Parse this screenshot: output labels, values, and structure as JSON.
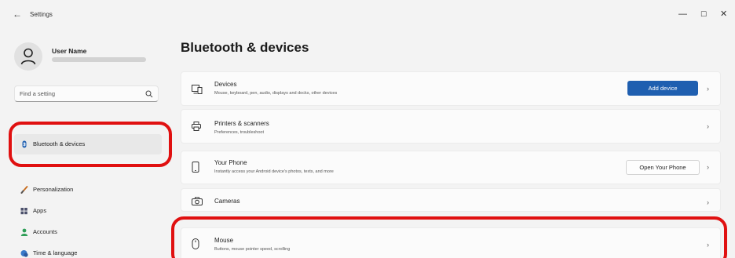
{
  "window": {
    "back_glyph": "←",
    "title": "Settings",
    "minimize_glyph": "—",
    "maximize_glyph": "☐",
    "close_glyph": "✕"
  },
  "user": {
    "name": "User Name"
  },
  "search": {
    "placeholder": "Find a setting"
  },
  "sidebar": {
    "items": [
      {
        "label": "Bluetooth & devices",
        "icon": "bluetooth-icon",
        "selected": true
      },
      {
        "label": "Personalization",
        "icon": "brush-icon"
      },
      {
        "label": "Apps",
        "icon": "apps-icon"
      },
      {
        "label": "Accounts",
        "icon": "person-icon"
      },
      {
        "label": "Time & language",
        "icon": "clock-globe-icon"
      }
    ]
  },
  "main": {
    "title": "Bluetooth & devices",
    "cards": [
      {
        "title": "Devices",
        "subtitle": "Mouse, keyboard, pen, audio, displays and docks, other devices",
        "button": "Add device",
        "icon": "devices-icon"
      },
      {
        "title": "Printers & scanners",
        "subtitle": "Preferences, troubleshoot",
        "icon": "printer-icon"
      },
      {
        "title": "Your Phone",
        "subtitle": "Instantly access your Android device's photos, texts, and more",
        "button": "Open Your Phone",
        "icon": "phone-icon"
      },
      {
        "title": "Cameras",
        "icon": "camera-icon"
      },
      {
        "title": "Mouse",
        "subtitle": "Buttons, mouse pointer speed, scrolling",
        "icon": "mouse-icon"
      }
    ],
    "chevron": "›"
  },
  "colors": {
    "accent": "#1f5fb0",
    "highlight": "#e01010",
    "background": "#f3f3f3"
  }
}
